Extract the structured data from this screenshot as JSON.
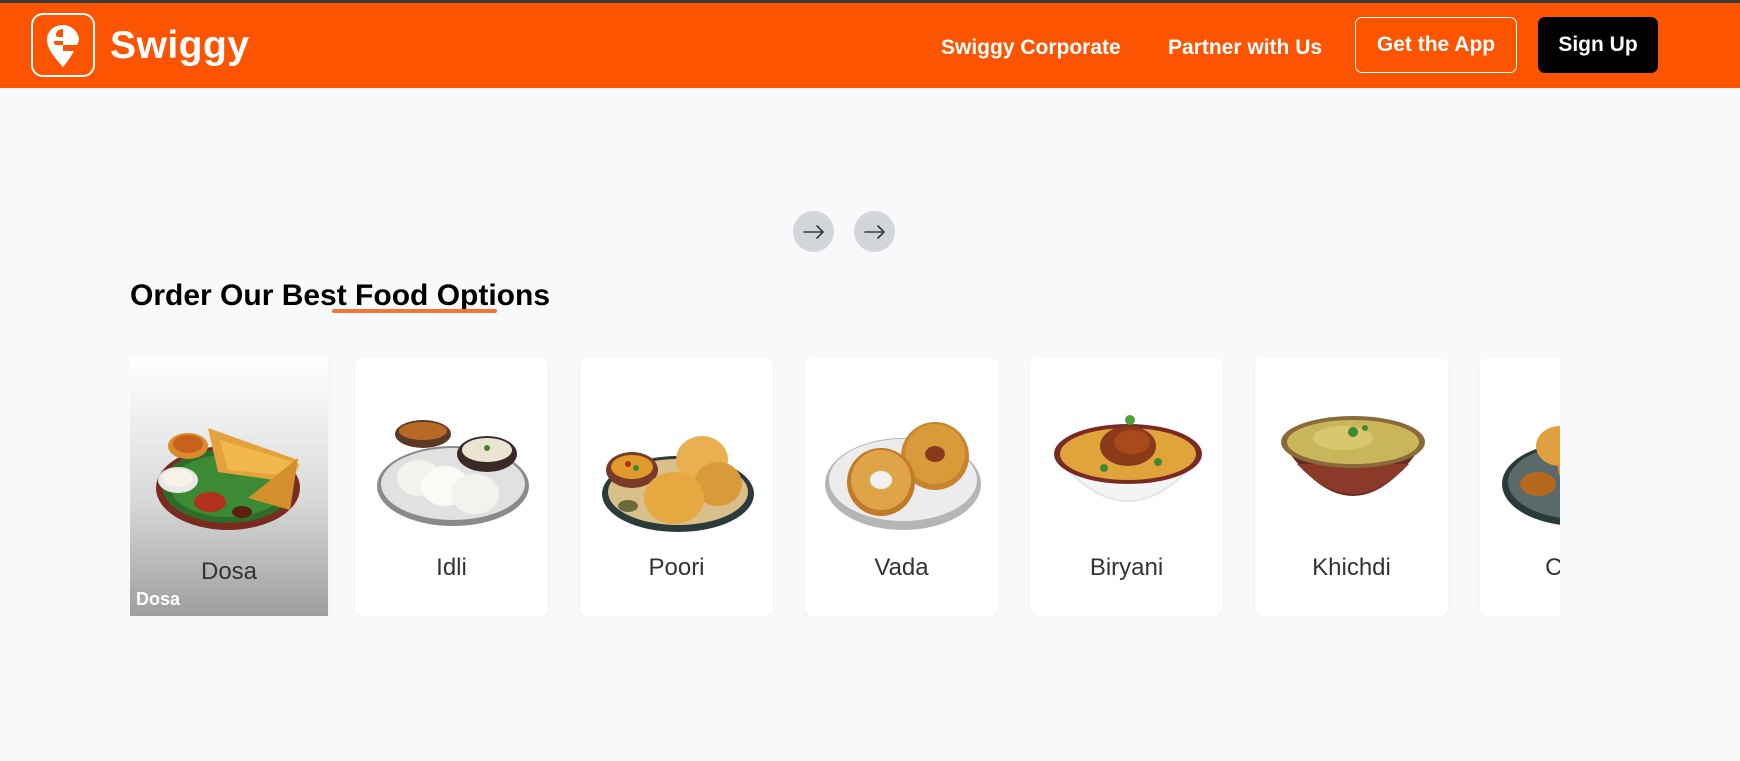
{
  "brand": {
    "name": "Swiggy",
    "color": "#fd5402"
  },
  "nav": {
    "corporate": "Swiggy Corporate",
    "partner": "Partner with Us",
    "get_app": "Get the App",
    "sign_up": "Sign Up"
  },
  "carousel_controls": {
    "prev_icon": "arrow-right-icon",
    "next_icon": "arrow-right-icon"
  },
  "section": {
    "title": "Order Our Best Food Options",
    "accent": "#f5772f"
  },
  "foods": [
    {
      "label": "Dosa",
      "tag": "Dosa",
      "active": true
    },
    {
      "label": "Idli"
    },
    {
      "label": "Poori"
    },
    {
      "label": "Vada"
    },
    {
      "label": "Biryani"
    },
    {
      "label": "Khichdi"
    },
    {
      "label": "Chole"
    }
  ]
}
